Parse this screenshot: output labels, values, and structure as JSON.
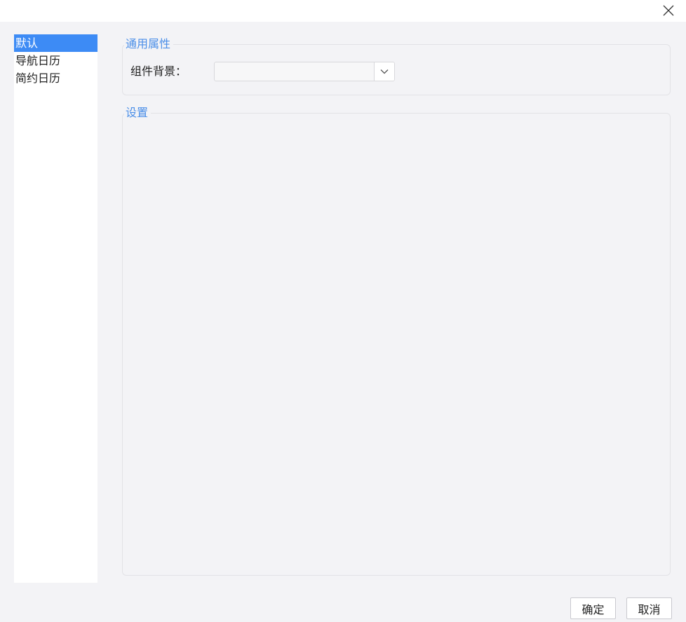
{
  "dialog": {
    "close_icon": "close-icon"
  },
  "sidebar": {
    "items": [
      {
        "label": "默认",
        "selected": true
      },
      {
        "label": "导航日历",
        "selected": false
      },
      {
        "label": "简约日历",
        "selected": false
      }
    ]
  },
  "general": {
    "legend": "通用属性",
    "background_label": "组件背景：",
    "background_value": ""
  },
  "settings": {
    "legend": "设置"
  },
  "footer": {
    "ok_label": "确定",
    "cancel_label": "取消"
  },
  "colors": {
    "selection": "#3d8bf5",
    "legend": "#4a8ee8",
    "panel_background": "#f3f3f6"
  }
}
